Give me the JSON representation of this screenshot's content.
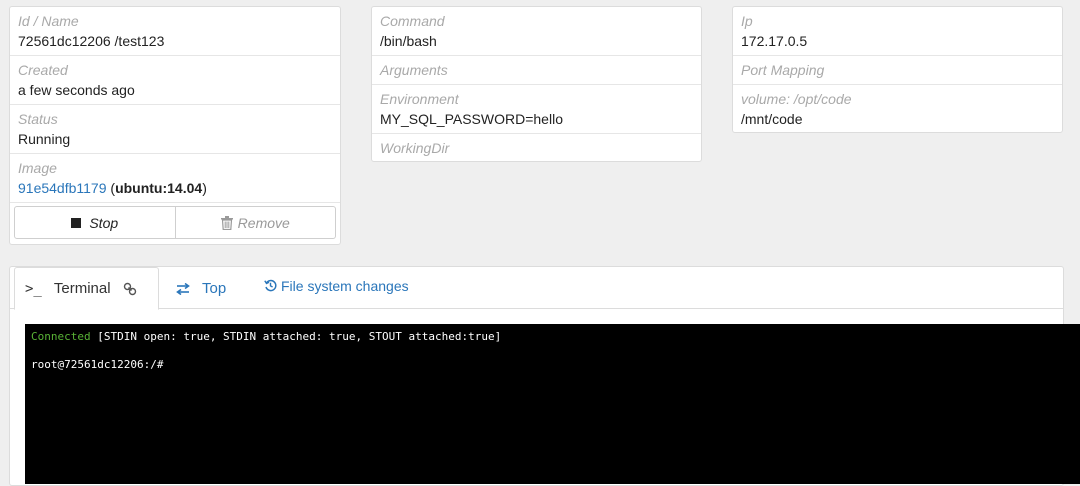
{
  "info": {
    "id_name": {
      "label": "Id / Name",
      "value": "72561dc12206 /test123"
    },
    "created": {
      "label": "Created",
      "value": "a few seconds ago"
    },
    "status": {
      "label": "Status",
      "value": "Running"
    },
    "image": {
      "label": "Image",
      "id": "91e54dfb1179",
      "name": "ubuntu:14.04"
    }
  },
  "actions": {
    "stop_label": "Stop",
    "remove_label": "Remove"
  },
  "config": {
    "command": {
      "label": "Command",
      "value": "/bin/bash"
    },
    "arguments": {
      "label": "Arguments"
    },
    "environment": {
      "label": "Environment",
      "value": "MY_SQL_PASSWORD=hello"
    },
    "working_dir": {
      "label": "WorkingDir"
    }
  },
  "network": {
    "ip": {
      "label": "Ip",
      "value": "172.17.0.5"
    },
    "port_mapping": {
      "label": "Port Mapping"
    },
    "volume": {
      "label": "volume: /opt/code",
      "value": "/mnt/code"
    }
  },
  "tabs": [
    {
      "label": "Terminal",
      "icon": "terminal-icon"
    },
    {
      "label": "Top",
      "icon": "swap-icon"
    },
    {
      "label": "File system changes",
      "icon": "history-icon"
    }
  ],
  "terminal": {
    "connected": "Connected",
    "status_detail": " [STDIN open: true, STDIN attached: true, STOUT attached:true]",
    "prompt": "root@72561dc12206:/#"
  },
  "colors": {
    "link": "#2a76ba",
    "connected": "#59b336",
    "terminal_bg": "#000000"
  }
}
